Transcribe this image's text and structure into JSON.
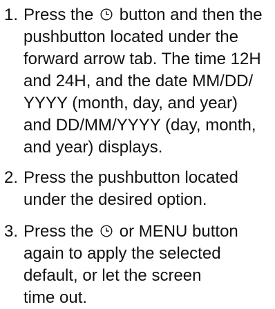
{
  "steps": [
    {
      "number": "1.",
      "lines": [
        [
          "Press the ",
          "clock-icon",
          " button and then the"
        ],
        [
          "pushbutton located under the"
        ],
        [
          "forward arrow tab. The time 12H"
        ],
        [
          "and 24H, and the date MM/DD/"
        ],
        [
          "YYYY (month, day, and year)"
        ],
        [
          "and DD/MM/YYYY (day, month,"
        ],
        [
          "and year) displays."
        ]
      ]
    },
    {
      "number": "2.",
      "lines": [
        [
          "Press the pushbutton located"
        ],
        [
          "under the desired option."
        ]
      ]
    },
    {
      "number": "3.",
      "lines": [
        [
          "Press the ",
          "clock-icon",
          " or MENU button"
        ],
        [
          "again to apply the selected"
        ],
        [
          "default, or let the screen"
        ],
        [
          "time out."
        ]
      ]
    }
  ]
}
